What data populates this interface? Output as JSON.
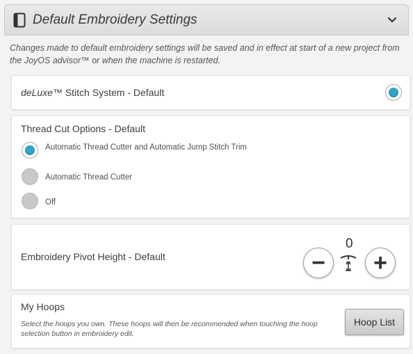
{
  "header": {
    "title": "Default Embroidery Settings",
    "icon": "panel-icon",
    "toggle_icon": "chevron-down-icon"
  },
  "intro": "Changes made to default embroidery settings will be saved and in effect at start of a new project from the JoyOS advisor™ or when the machine is restarted.",
  "deluxe": {
    "label_italic": "deLuxe",
    "label_rest": "™ Stitch System - Default",
    "selected": true
  },
  "thread_cut": {
    "title": "Thread Cut Options - Default",
    "options": [
      {
        "label": "Automatic Thread Cutter and Automatic Jump Stitch Trim",
        "selected": true
      },
      {
        "label": "Automatic Thread Cutter",
        "selected": false
      },
      {
        "label": "Off",
        "selected": false
      }
    ]
  },
  "pivot": {
    "label": "Embroidery Pivot Height - Default",
    "value": "0",
    "minus": "−",
    "plus": "+"
  },
  "hoops": {
    "title": "My Hoops",
    "description": "Select the hoops you own. These hoops will then be recommended when touching the hoop selection button in embroidery edit.",
    "button_label": "Hoop List"
  },
  "colors": {
    "accent": "#33a4c6",
    "header_bg": "#dcdcdc",
    "card_bg": "#ffffff"
  }
}
